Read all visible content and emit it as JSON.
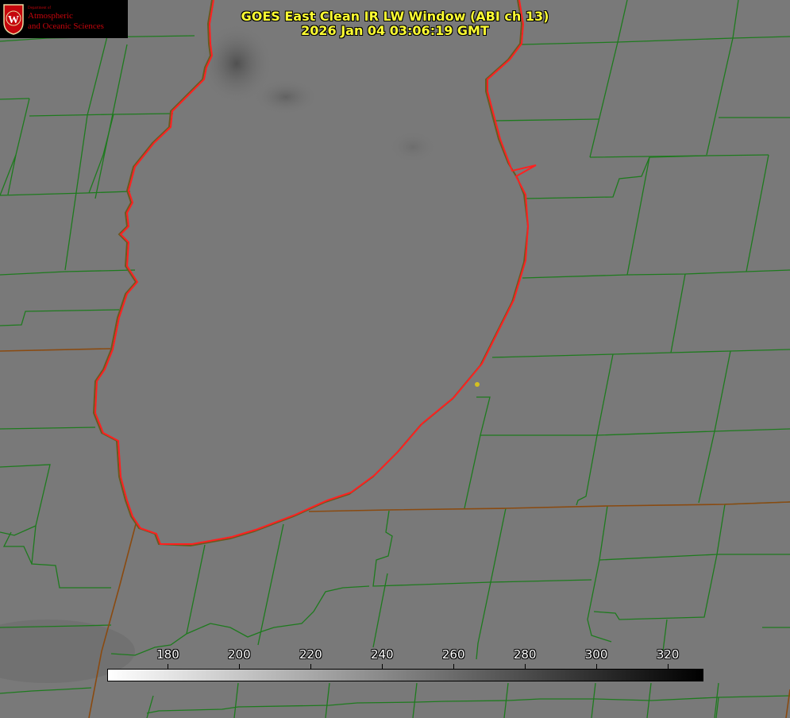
{
  "header": {
    "title": "GOES East Clean IR LW Window (ABI ch 13)",
    "timestamp": "2026 Jan 04 03:06:19 GMT"
  },
  "logo": {
    "department": "Department of",
    "line1": "Atmospheric",
    "line2": "and Oceanic Sciences",
    "seal_letter": "W",
    "icon": "uw-seal-icon",
    "color": "#c5050c"
  },
  "colorbar": {
    "min": 163,
    "max": 330,
    "ticks": [
      180,
      200,
      220,
      240,
      260,
      280,
      300,
      320
    ],
    "low_color": "#ffffff",
    "high_color": "#000000"
  },
  "map": {
    "background_color": "#777777",
    "county_line_color": "#1e7a1e",
    "state_line_color": "#8a4a10",
    "lake_outline_color": "#ff2020",
    "marker_color": "#d4c020"
  }
}
